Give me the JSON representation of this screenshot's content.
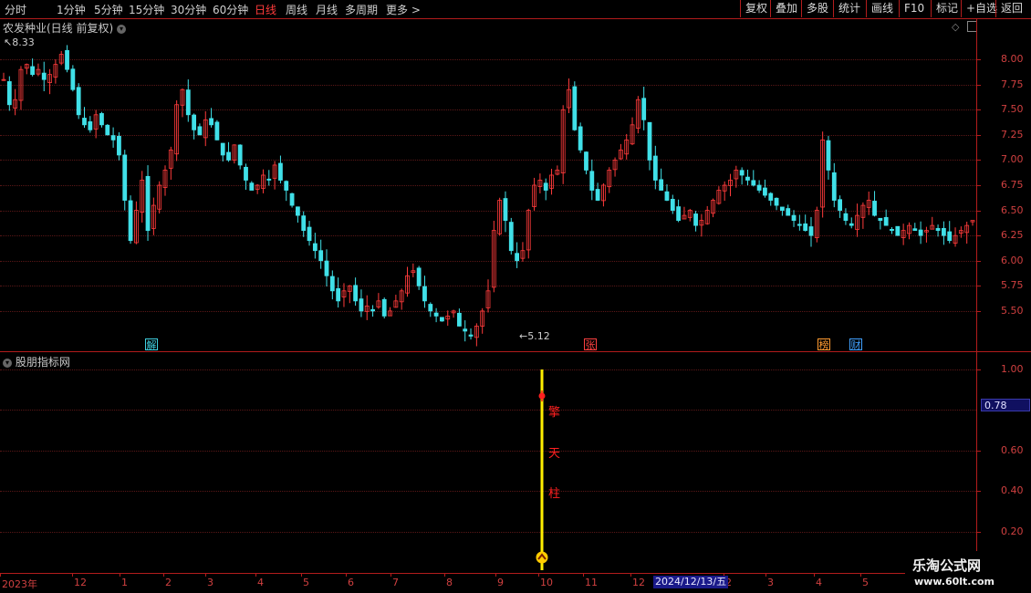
{
  "toolbar": {
    "timeframes": [
      "分时",
      "1分钟",
      "5分钟",
      "15分钟",
      "30分钟",
      "60分钟",
      "日线",
      "周线",
      "月线",
      "多周期",
      "更多 >"
    ],
    "active_timeframe": "日线",
    "buttons": [
      "复权",
      "叠加",
      "多股",
      "统计",
      "画线",
      "F10",
      "标记",
      "+自选",
      "返回"
    ]
  },
  "main_chart": {
    "title": "农发种业(日线 前复权)",
    "high_label": "8.33",
    "low_label": "5.12",
    "y_labels": [
      "8.00",
      "7.75",
      "7.50",
      "7.25",
      "7.00",
      "6.75",
      "6.50",
      "6.25",
      "6.00",
      "5.75",
      "5.50"
    ],
    "markers": [
      {
        "text": "解",
        "color": "#3fd0e0"
      },
      {
        "text": "张",
        "color": "#ff4040"
      },
      {
        "text": "榜",
        "color": "#ff9a30"
      },
      {
        "text": "财",
        "color": "#40a0ff"
      }
    ]
  },
  "indicator": {
    "title": "股朋指标网",
    "y_labels": [
      "1.00",
      "0.60",
      "0.40",
      "0.20"
    ],
    "current_value": "0.78",
    "signal_chars": [
      "擎",
      "天",
      "柱"
    ]
  },
  "x_axis": {
    "labels": [
      "2023年",
      "12",
      "1",
      "2",
      "3",
      "4",
      "5",
      "6",
      "7",
      "8",
      "9",
      "10",
      "11",
      "12",
      "2",
      "3",
      "4",
      "5"
    ],
    "highlight_date": "2024/12/13/五"
  },
  "watermark": {
    "line1": "乐淘公式网",
    "line2": "www.60lt.com"
  },
  "chart_data": {
    "type": "candlestick",
    "ylim": [
      5.1,
      8.4
    ],
    "closes": [
      7.8,
      7.55,
      7.6,
      7.9,
      7.95,
      7.85,
      7.9,
      7.8,
      7.85,
      7.95,
      8.05,
      7.9,
      7.7,
      7.45,
      7.35,
      7.3,
      7.45,
      7.35,
      7.25,
      7.2,
      7.05,
      6.6,
      6.2,
      6.5,
      6.8,
      6.3,
      6.55,
      6.75,
      6.9,
      7.1,
      7.55,
      7.7,
      7.45,
      7.3,
      7.25,
      7.4,
      7.35,
      7.2,
      7.05,
      7.0,
      7.15,
      6.95,
      6.8,
      6.7,
      6.75,
      6.85,
      6.8,
      6.95,
      6.8,
      6.7,
      6.55,
      6.45,
      6.3,
      6.2,
      6.1,
      6.0,
      5.85,
      5.7,
      5.6,
      5.7,
      5.75,
      5.6,
      5.5,
      5.55,
      5.5,
      5.6,
      5.45,
      5.5,
      5.6,
      5.7,
      5.85,
      5.9,
      5.75,
      5.6,
      5.5,
      5.45,
      5.4,
      5.45,
      5.5,
      5.35,
      5.3,
      5.25,
      5.35,
      5.5,
      5.7,
      6.3,
      6.6,
      6.4,
      6.1,
      6.0,
      6.1,
      6.5,
      6.75,
      6.8,
      6.7,
      6.85,
      6.9,
      7.5,
      7.7,
      7.3,
      7.1,
      6.9,
      6.7,
      6.6,
      6.75,
      6.9,
      7.0,
      7.1,
      7.2,
      7.35,
      7.6,
      7.4,
      7.0,
      6.8,
      6.7,
      6.6,
      6.5,
      6.4,
      6.45,
      6.5,
      6.35,
      6.4,
      6.5,
      6.6,
      6.7,
      6.75,
      6.8,
      6.9,
      6.85,
      6.8,
      6.75,
      6.7,
      6.65,
      6.6,
      6.55,
      6.5,
      6.45,
      6.4,
      6.35,
      6.3,
      6.25,
      6.5,
      7.2,
      6.9,
      6.6,
      6.5,
      6.4,
      6.35,
      6.45,
      6.55,
      6.6,
      6.45,
      6.4,
      6.35,
      6.3,
      6.25,
      6.3,
      6.35,
      6.3,
      6.25,
      6.3,
      6.35,
      6.3,
      6.25,
      6.2,
      6.25,
      6.3,
      6.35,
      6.4
    ]
  }
}
